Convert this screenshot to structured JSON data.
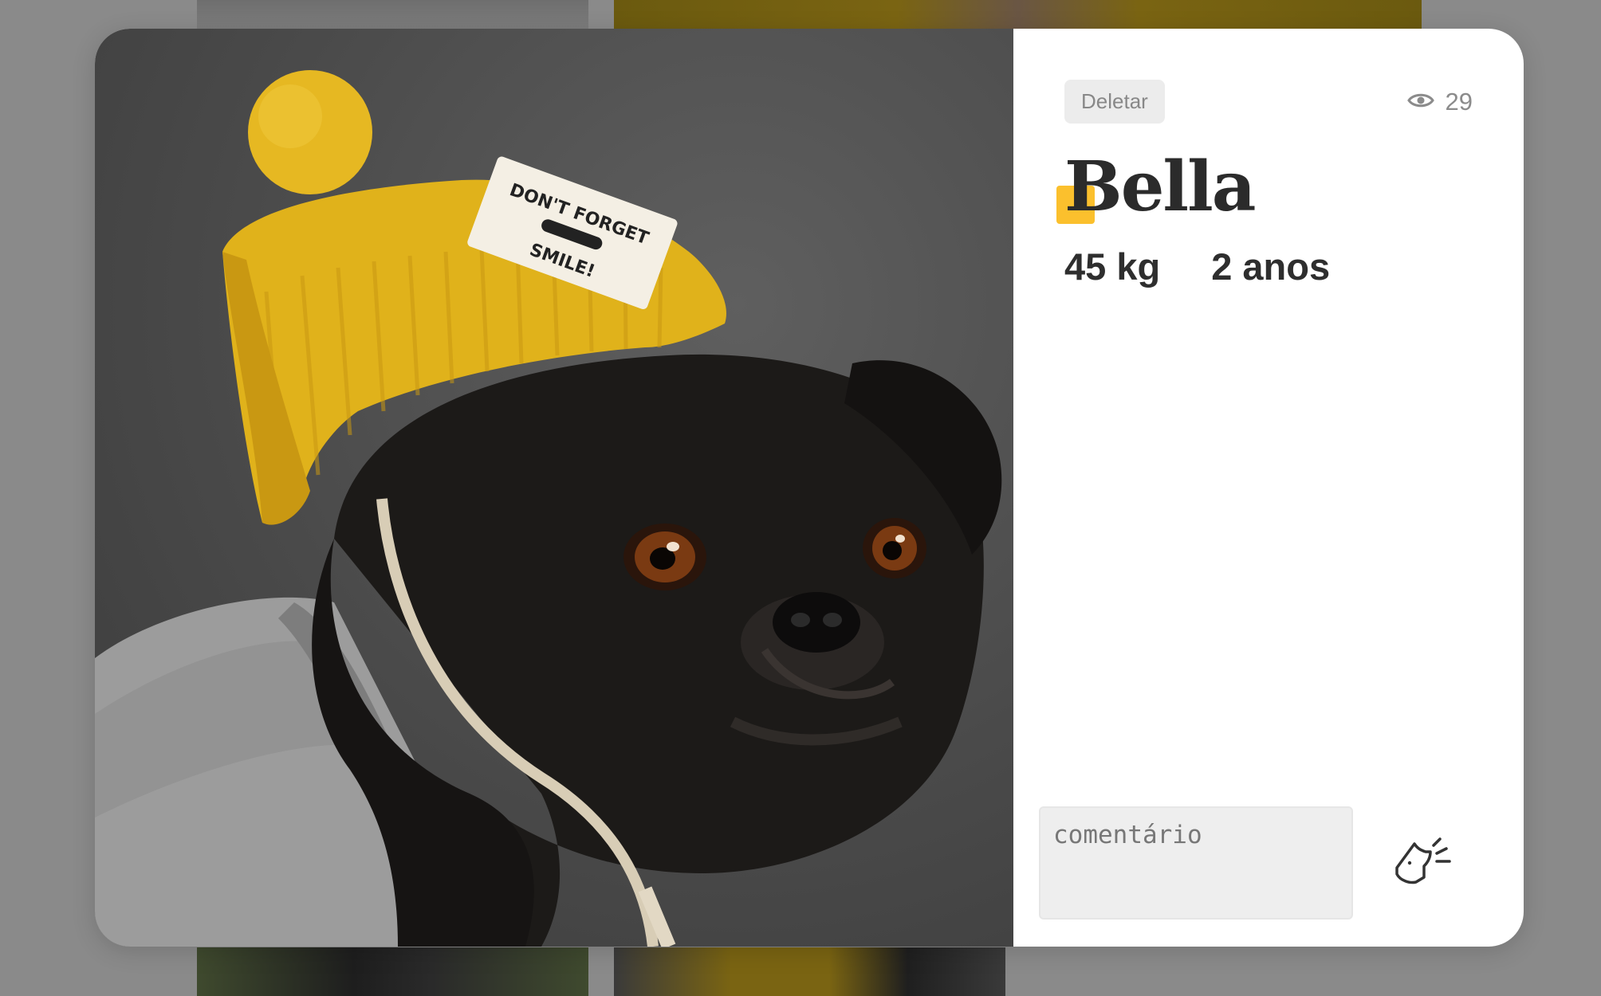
{
  "photo": {
    "alt": "Bella",
    "hat_patch_text_1": "DON'T FORGET",
    "hat_patch_text_2": "SMILE!"
  },
  "post": {
    "delete_label": "Deletar",
    "views_count": "29",
    "pet_name": "Bella",
    "weight": "45 kg",
    "age": "2 anos"
  },
  "comment": {
    "placeholder": "comentário",
    "value": ""
  },
  "icons": {
    "views": "eye-icon",
    "send": "dog-bark-icon"
  },
  "colors": {
    "accent": "#fbc02d",
    "text": "#2b2b2b",
    "muted": "#888888",
    "input_bg": "#eeeeee"
  }
}
